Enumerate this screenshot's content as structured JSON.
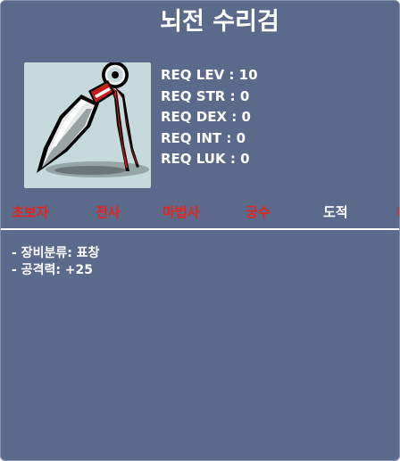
{
  "item": {
    "name": "뇌전 수리검",
    "icon": "throwing-star-icon"
  },
  "requirements": [
    {
      "label": "REQ LEV",
      "value": "10"
    },
    {
      "label": "REQ STR",
      "value": "0"
    },
    {
      "label": "REQ DEX",
      "value": "0"
    },
    {
      "label": "REQ INT",
      "value": "0"
    },
    {
      "label": "REQ LUK",
      "value": "0"
    }
  ],
  "jobs": [
    {
      "name": "초보자",
      "color": "#e8231e"
    },
    {
      "name": "전사",
      "color": "#e8231e"
    },
    {
      "name": "마법사",
      "color": "#e8231e"
    },
    {
      "name": "궁수",
      "color": "#e8231e"
    },
    {
      "name": "도적",
      "color": "#ffffff"
    },
    {
      "name": "해적",
      "color": "#e8231e"
    }
  ],
  "stats": [
    "- 장비분류: 표창",
    "- 공격력: +25"
  ],
  "colors": {
    "background": "#5b6a8a",
    "restricted_job": "#e8231e",
    "allowed_job": "#ffffff"
  }
}
